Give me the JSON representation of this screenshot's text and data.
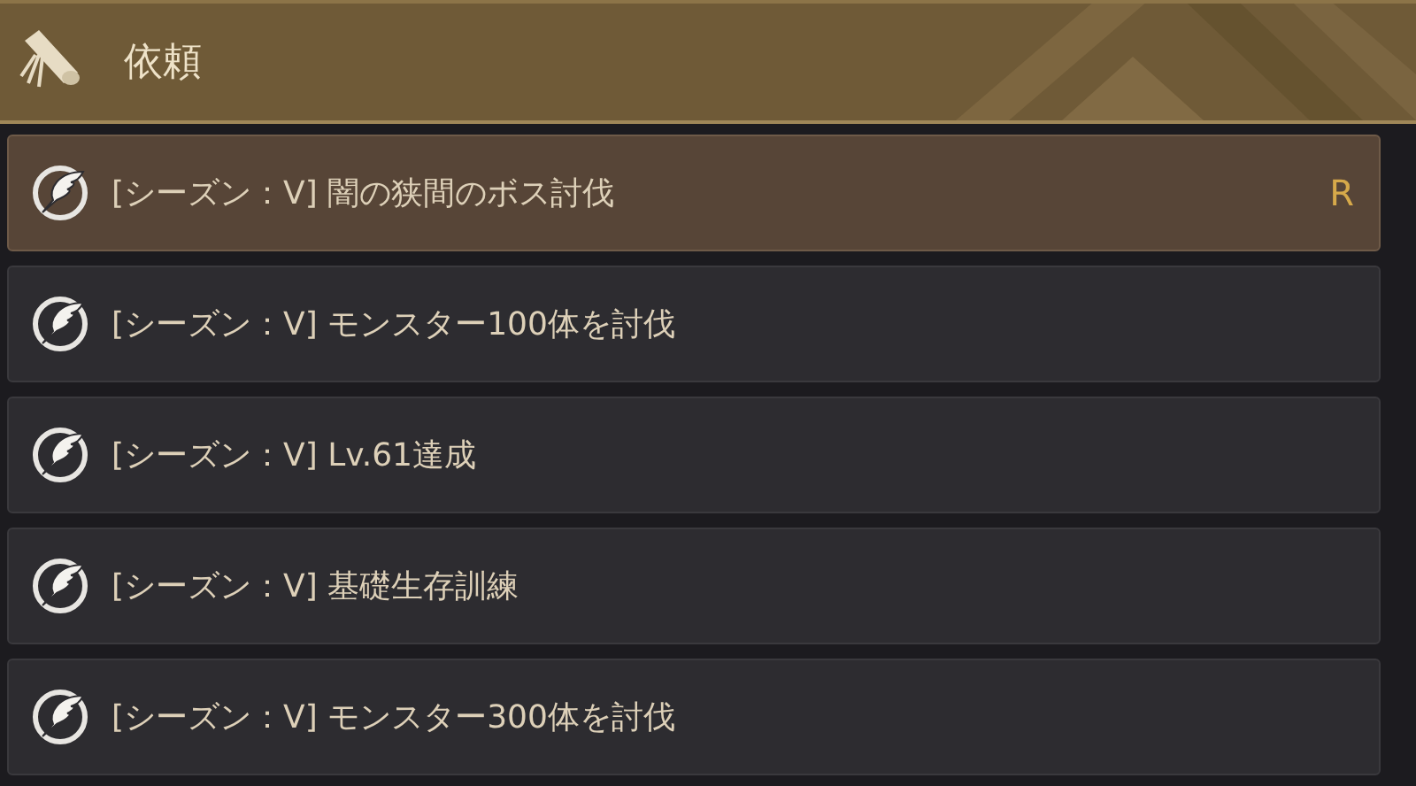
{
  "header": {
    "title": "依頼"
  },
  "quests": [
    {
      "label": "[シーズン：V] 闇の狭間のボス討伐",
      "selected": true,
      "badge": "R"
    },
    {
      "label": "[シーズン：V] モンスター100体を討伐",
      "selected": false
    },
    {
      "label": "[シーズン：V] Lv.61達成",
      "selected": false
    },
    {
      "label": "[シーズン：V] 基礎生存訓練",
      "selected": false
    },
    {
      "label": "[シーズン：V] モンスター300体を討伐",
      "selected": false
    }
  ]
}
